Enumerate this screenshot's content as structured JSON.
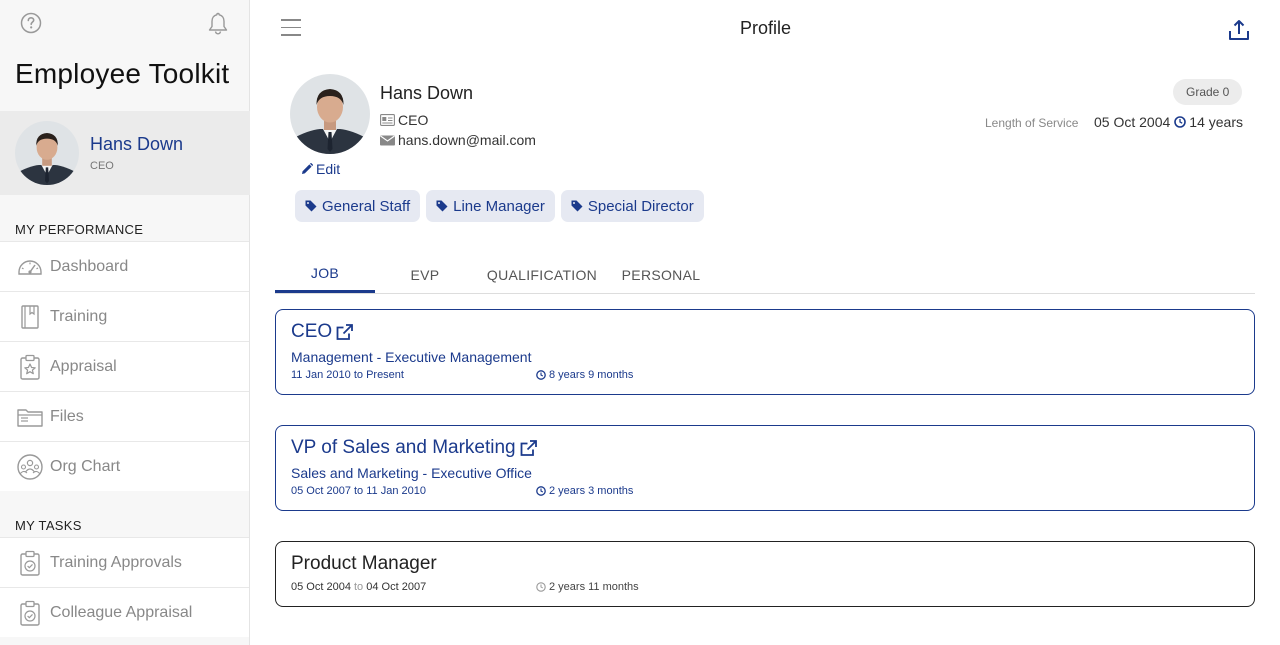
{
  "app": {
    "title": "Employee Toolkit"
  },
  "user": {
    "name": "Hans Down",
    "role": "CEO"
  },
  "sidebar": {
    "sections": [
      {
        "title": "MY PERFORMANCE"
      },
      {
        "title": "MY TASKS"
      }
    ],
    "items": [
      {
        "label": "Dashboard",
        "icon": "speedometer-icon"
      },
      {
        "label": "Training",
        "icon": "book-icon"
      },
      {
        "label": "Appraisal",
        "icon": "clipboard-star-icon"
      },
      {
        "label": "Files",
        "icon": "folder-icon"
      },
      {
        "label": "Org Chart",
        "icon": "people-circle-icon"
      },
      {
        "label": "Training Approvals",
        "icon": "clipboard-check-icon"
      },
      {
        "label": "Colleague Appraisal",
        "icon": "clipboard-check-icon"
      }
    ]
  },
  "header": {
    "title": "Profile"
  },
  "profile": {
    "name": "Hans Down",
    "role": "CEO",
    "email": "hans.down@mail.com",
    "edit_label": "Edit",
    "grade": "Grade 0",
    "length_of_service_label": "Length of Service",
    "start_date": "05 Oct 2004",
    "service_years": "14 years",
    "tags": [
      "General Staff",
      "Line Manager",
      "Special Director"
    ]
  },
  "tabs": [
    "JOB",
    "EVP",
    "QUALIFICATION",
    "PERSONAL"
  ],
  "active_tab": "JOB",
  "jobs": [
    {
      "title": "CEO",
      "department": "Management - Executive Management",
      "from": "11 Jan 2010",
      "to_word": "to",
      "until": "Present",
      "duration": "8 years 9 months"
    },
    {
      "title": "VP of Sales and Marketing",
      "department": "Sales and Marketing - Executive Office",
      "from": "05 Oct 2007",
      "to_word": "to",
      "until": "11 Jan 2010",
      "duration": "2 years 3 months"
    },
    {
      "title": "Product Manager",
      "from": "05 Oct 2004",
      "to_word": "to",
      "until": "04 Oct 2007",
      "duration": "2 years 11 months"
    }
  ],
  "colors": {
    "accent": "#1b3a8c",
    "muted": "#888888",
    "sidebar_bg": "#f7f7f7",
    "tag_bg": "#e6e9f2"
  }
}
